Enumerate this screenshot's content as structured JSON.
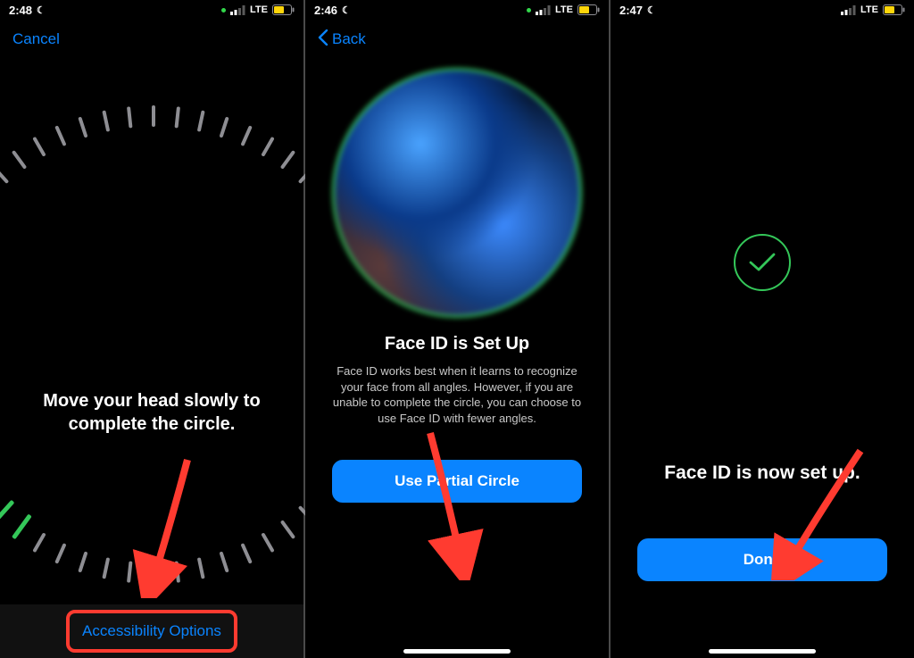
{
  "accent_blue": "#0a84ff",
  "accent_green": "#34c759",
  "accent_red": "#ff3b30",
  "status": {
    "lte": "LTE"
  },
  "screens": [
    {
      "time": "2:48",
      "nav_cancel": "Cancel",
      "instruction": "Move your head slowly to complete the circle.",
      "accessibility_button": "Accessibility Options",
      "tick_count": 60,
      "tick_active_start": 36,
      "tick_active_end": 46
    },
    {
      "time": "2:46",
      "nav_back": "Back",
      "title": "Face ID is Set Up",
      "body": "Face ID works best when it learns to recognize your face from all angles. However, if you are unable to complete the circle, you can choose to use Face ID with fewer angles.",
      "primary_button": "Use Partial Circle"
    },
    {
      "time": "2:47",
      "title": "Face ID is now set up.",
      "primary_button": "Done"
    }
  ]
}
